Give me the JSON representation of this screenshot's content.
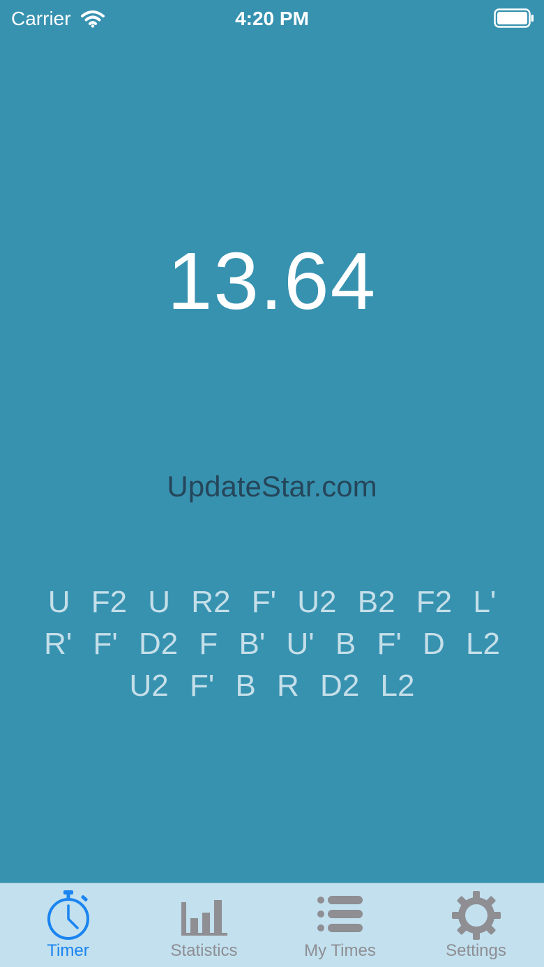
{
  "status_bar": {
    "carrier": "Carrier",
    "time": "4:20 PM"
  },
  "timer": {
    "value": "13.64"
  },
  "watermark": "UpdateStar.com",
  "scramble": "U F2 U R2 F' U2 B2 F2 L' R' F' D2 F B' U' B F' D L2 U2 F' B R D2 L2",
  "tabs": [
    {
      "label": "Timer",
      "icon": "stopwatch-icon",
      "active": true
    },
    {
      "label": "Statistics",
      "icon": "bar-chart-icon",
      "active": false
    },
    {
      "label": "My Times",
      "icon": "list-icon",
      "active": false
    },
    {
      "label": "Settings",
      "icon": "gear-icon",
      "active": false
    }
  ],
  "colors": {
    "background": "#3792b0",
    "tab_bar": "#c2e0ee",
    "active_tint": "#1a84f0",
    "inactive_tint": "#8e8e93"
  }
}
